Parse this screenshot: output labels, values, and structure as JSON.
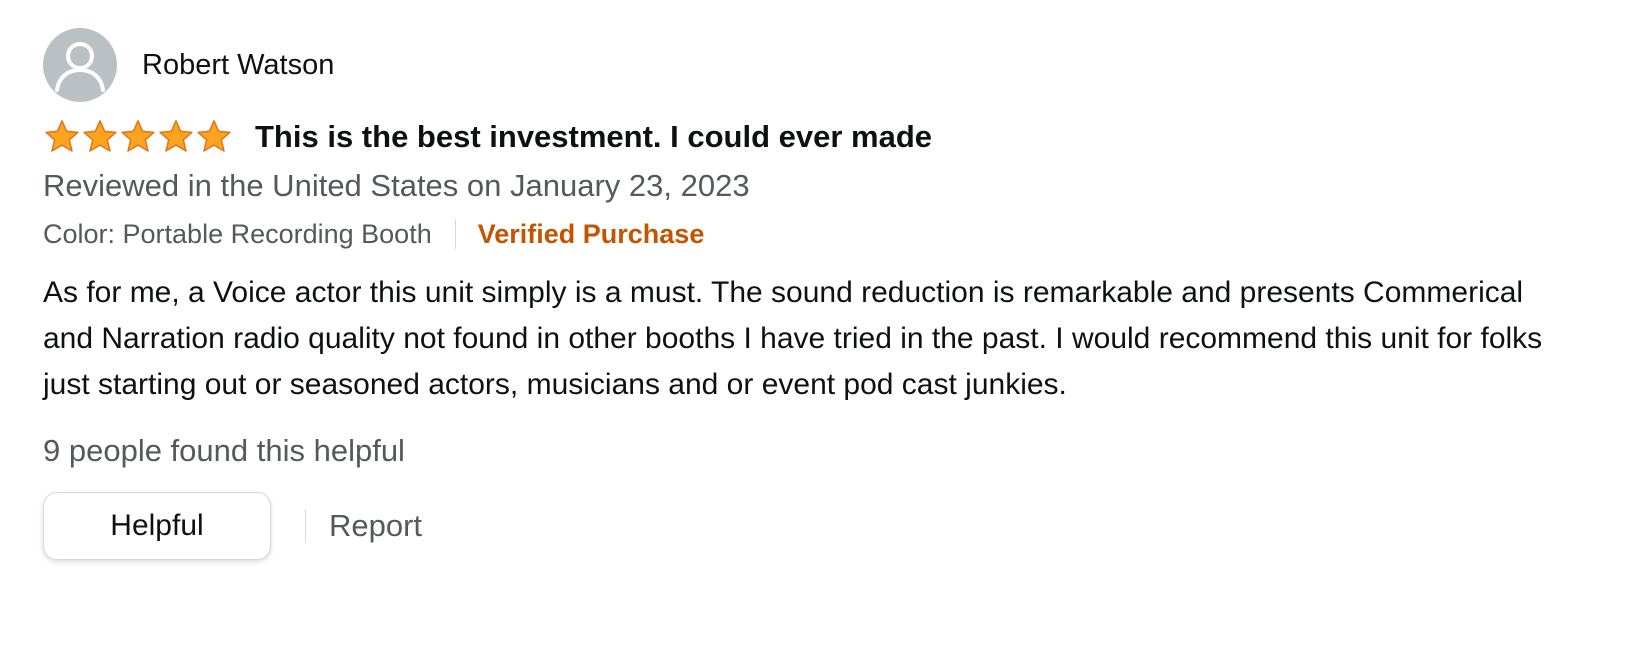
{
  "reviewer": {
    "name": "Robert Watson",
    "avatar_icon": "user-silhouette-icon"
  },
  "rating": {
    "stars": 5,
    "out_of": 5,
    "star_color": "#ffa41c"
  },
  "review": {
    "title": "This is the best investment. I could ever made",
    "date": "Reviewed in the United States on January 23, 2023",
    "variant": "Color: Portable Recording Booth",
    "verified_label": "Verified Purchase",
    "body": "As for me, a Voice actor this unit simply is a must. The sound reduction is remarkable and presents Commerical and Narration radio quality not found in other booths I have tried in the past. I would recommend this unit for folks just starting out or seasoned actors, musicians and or event pod cast junkies.",
    "helpful_count_text": "9 people found this helpful"
  },
  "actions": {
    "helpful_label": "Helpful",
    "report_label": "Report"
  },
  "colors": {
    "verified": "#c45500",
    "secondary_text": "#565959",
    "primary_text": "#0f1111"
  }
}
